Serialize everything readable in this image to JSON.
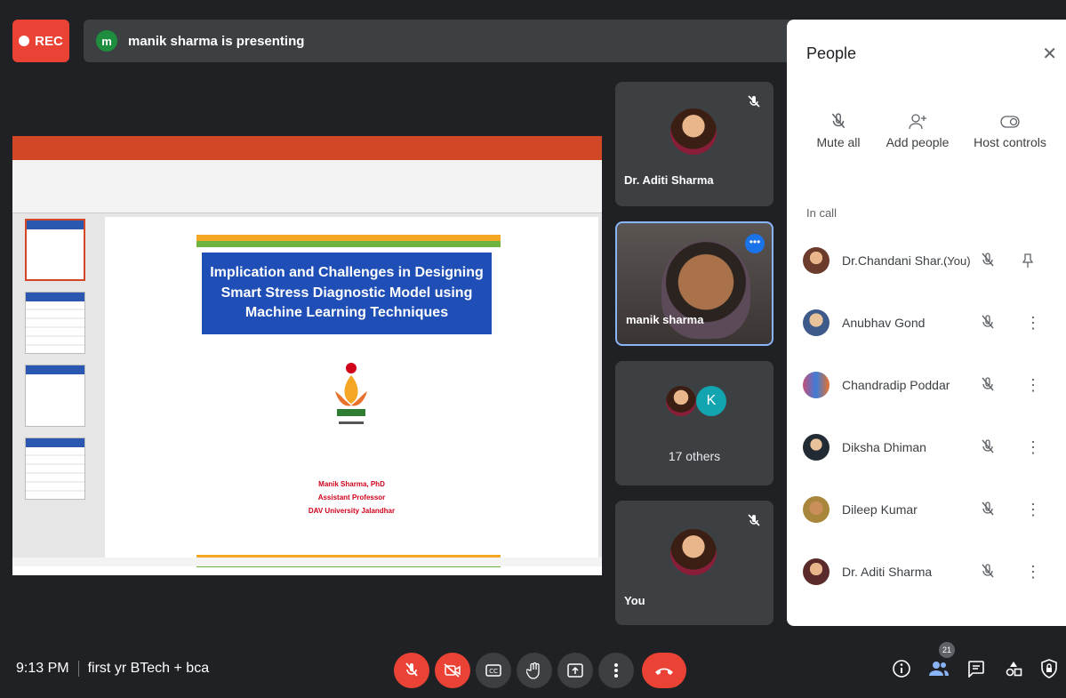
{
  "recording": {
    "label": "REC"
  },
  "presenter_bar": {
    "avatar_letter": "m",
    "text": "manik sharma is presenting"
  },
  "slide": {
    "title": "Implication and Challenges in Designing Smart Stress Diagnostic Model using Machine Learning Techniques",
    "author_lines": [
      "Manik Sharma, PhD",
      "Assistant Professor",
      "DAV University Jalandhar"
    ]
  },
  "tiles": [
    {
      "name": "Dr. Aditi Sharma",
      "muted": true
    },
    {
      "name": "manik sharma",
      "muted": false
    },
    {
      "label": "17 others",
      "avatar_letter": "K"
    },
    {
      "name": "You",
      "muted": true
    }
  ],
  "panel": {
    "title": "People",
    "actions": [
      "Mute all",
      "Add people",
      "Host controls"
    ],
    "section": "In call",
    "participants": [
      {
        "name": "Dr.Chandani Shar...",
        "suffix": "(You)",
        "color": "#6b3b2c"
      },
      {
        "name": "Anubhav Gond",
        "color": "#3d5a8a"
      },
      {
        "name": "Chandradip Poddar",
        "color": "#c44f7a"
      },
      {
        "name": "Diksha Dhiman",
        "color": "#222b33"
      },
      {
        "name": "Dileep Kumar",
        "color": "#a8873c"
      },
      {
        "name": "Dr. Aditi Sharma",
        "color": "#5b2a2a"
      }
    ]
  },
  "bottom": {
    "time": "9:13 PM",
    "meeting": "first yr BTech + bca",
    "participant_count": "21"
  },
  "colors": {
    "danger": "#ea4335",
    "accent": "#1a73e8",
    "bar": "#3c4043"
  }
}
